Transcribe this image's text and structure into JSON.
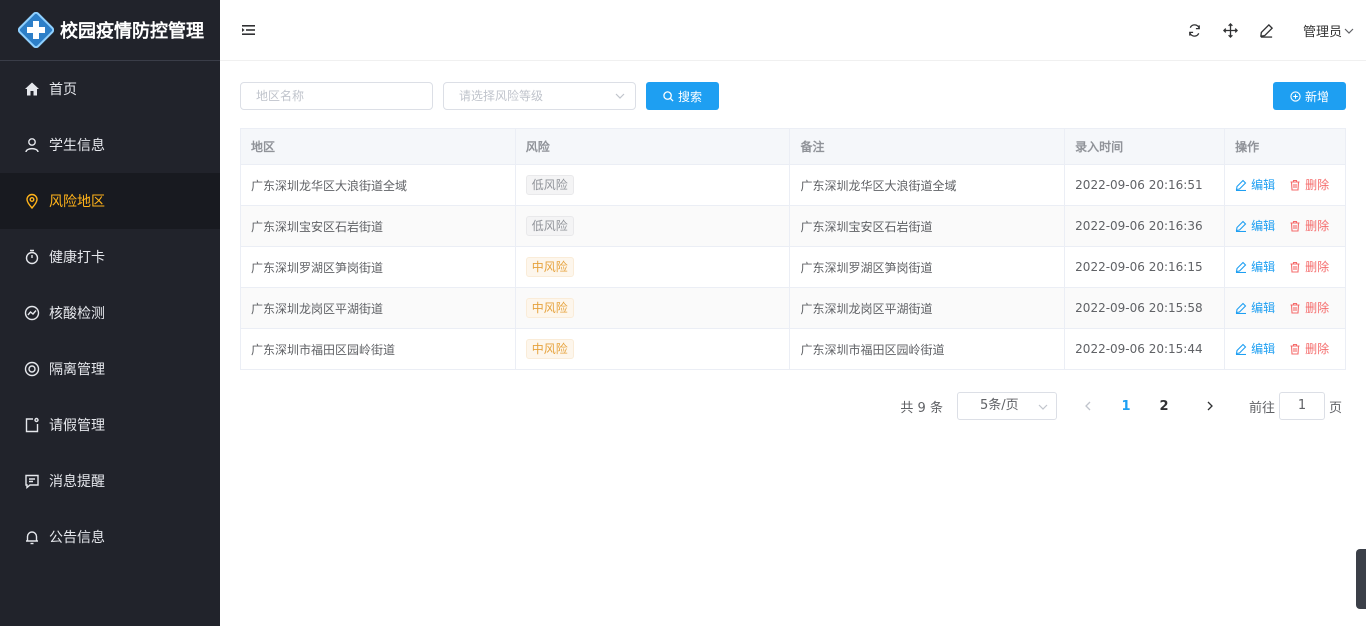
{
  "app": {
    "title": "校园疫情防控管理"
  },
  "sidebar": {
    "items": [
      {
        "label": "首页",
        "icon": "home-icon"
      },
      {
        "label": "学生信息",
        "icon": "user-icon"
      },
      {
        "label": "风险地区",
        "icon": "location-icon",
        "active": true
      },
      {
        "label": "健康打卡",
        "icon": "stopwatch-icon"
      },
      {
        "label": "核酸检测",
        "icon": "chart-circle-icon"
      },
      {
        "label": "隔离管理",
        "icon": "lifebuoy-icon"
      },
      {
        "label": "请假管理",
        "icon": "note-icon"
      },
      {
        "label": "消息提醒",
        "icon": "message-icon"
      },
      {
        "label": "公告信息",
        "icon": "bell-icon"
      }
    ]
  },
  "header": {
    "user": "管理员"
  },
  "filters": {
    "region_placeholder": "地区名称",
    "risk_placeholder": "请选择风险等级",
    "search_label": "搜索",
    "add_label": "新增"
  },
  "table": {
    "columns": [
      "地区",
      "风险",
      "备注",
      "录入时间",
      "操作"
    ],
    "rows": [
      {
        "region": "广东深圳龙华区大浪街道全域",
        "risk": "低风险",
        "level": "low",
        "note": "广东深圳龙华区大浪街道全域",
        "time": "2022-09-06 20:16:51"
      },
      {
        "region": "广东深圳宝安区石岩街道",
        "risk": "低风险",
        "level": "low",
        "note": "广东深圳宝安区石岩街道",
        "time": "2022-09-06 20:16:36"
      },
      {
        "region": "广东深圳罗湖区笋岗街道",
        "risk": "中风险",
        "level": "mid",
        "note": "广东深圳罗湖区笋岗街道",
        "time": "2022-09-06 20:16:15"
      },
      {
        "region": "广东深圳龙岗区平湖街道",
        "risk": "中风险",
        "level": "mid",
        "note": "广东深圳龙岗区平湖街道",
        "time": "2022-09-06 20:15:58"
      },
      {
        "region": "广东深圳市福田区园岭街道",
        "risk": "中风险",
        "level": "mid",
        "note": "广东深圳市福田区园岭街道",
        "time": "2022-09-06 20:15:44"
      }
    ],
    "edit_label": "编辑",
    "delete_label": "删除"
  },
  "pagination": {
    "total": "共 9 条",
    "page_size": "5条/页",
    "pages": [
      "1",
      "2"
    ],
    "current": "1",
    "goto_label": "前往",
    "goto_value": "1",
    "page_suffix": "页"
  },
  "colors": {
    "sidebar_bg": "#21232b",
    "active_text": "#ffb31a",
    "primary": "#1e9ff2",
    "danger": "#f56c6c",
    "warning": "#e6a23c"
  }
}
